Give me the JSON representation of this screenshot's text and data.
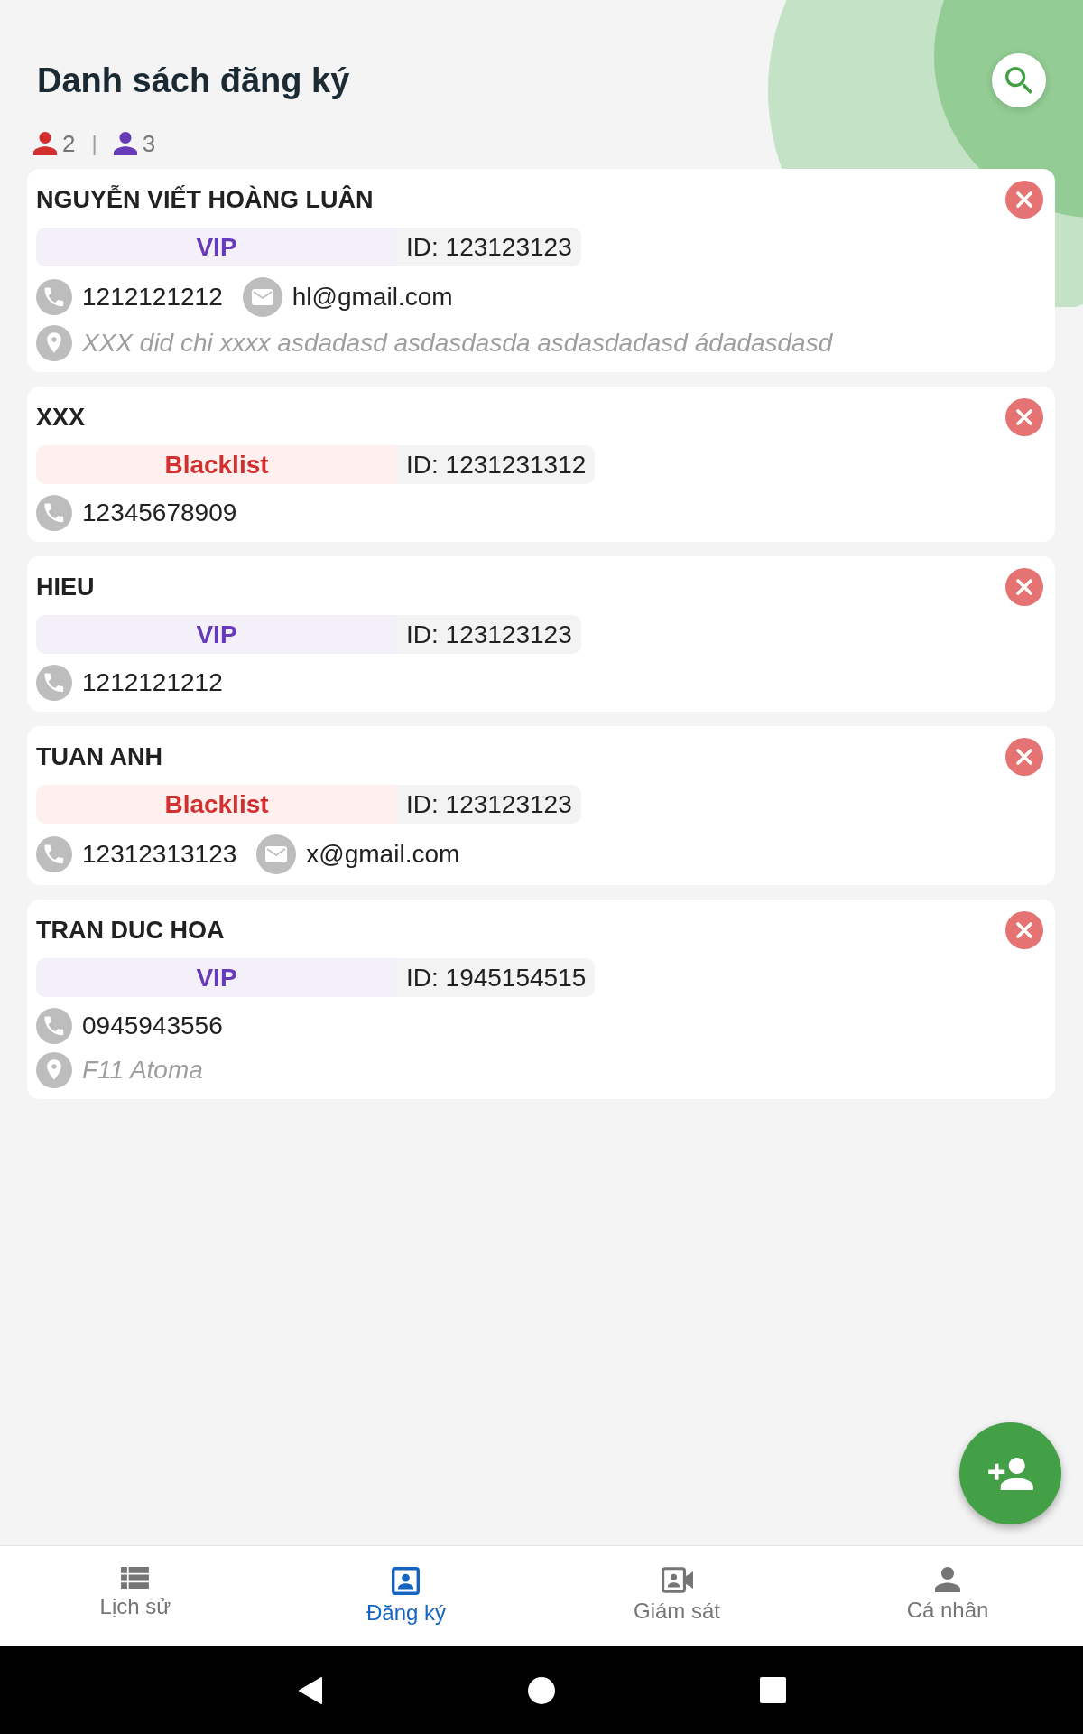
{
  "header": {
    "title": "Danh sách đăng ký"
  },
  "counts": {
    "items": [
      {
        "count": "2",
        "color": "#d32f2f"
      },
      {
        "count": "3",
        "color": "#673ab7"
      }
    ],
    "separator": "|"
  },
  "registrations": [
    {
      "name": "NGUYỄN VIẾT HOÀNG LUÂN",
      "tag": {
        "kind": "vip",
        "label": "VIP"
      },
      "id": "ID: 123123123",
      "phone": "1212121212",
      "email": "hl@gmail.com",
      "address": "XXX did chi xxxx asdadasd asdasdasda asdasdadasd ádadasdasd"
    },
    {
      "name": "XXX",
      "tag": {
        "kind": "blacklist",
        "label": "Blacklist"
      },
      "id": "ID: 1231231312",
      "phone": "12345678909"
    },
    {
      "name": "HIEU",
      "tag": {
        "kind": "vip",
        "label": "VIP"
      },
      "id": "ID: 123123123",
      "phone": "1212121212"
    },
    {
      "name": "TUAN ANH",
      "tag": {
        "kind": "blacklist",
        "label": "Blacklist"
      },
      "id": "ID: 123123123",
      "phone": "12312313123",
      "email": "x@gmail.com"
    },
    {
      "name": "TRAN DUC HOA",
      "tag": {
        "kind": "vip",
        "label": "VIP"
      },
      "id": "ID: 1945154515",
      "phone": "0945943556",
      "address": "F11 Atoma"
    }
  ],
  "nav": {
    "tabs": [
      {
        "label": "Lịch sử",
        "selected": false
      },
      {
        "label": "Đăng ký",
        "selected": true
      },
      {
        "label": "Giám sát",
        "selected": false
      },
      {
        "label": "Cá nhân",
        "selected": false
      }
    ]
  }
}
